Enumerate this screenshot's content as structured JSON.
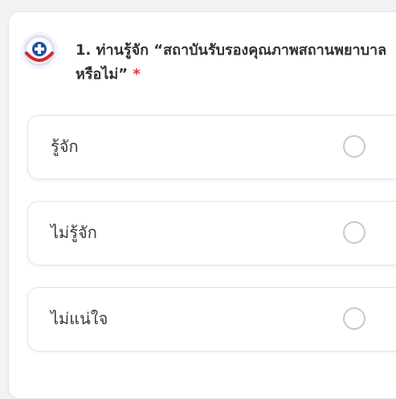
{
  "question": {
    "text": "1. ท่านรู้จัก “สถาบันรับรองคุณภาพสถานพยาบาลหรือไม่”",
    "required_marker": "*",
    "logo_icon": "hospital-accreditation-logo-icon"
  },
  "options": [
    {
      "label": "รู้จัก",
      "selected": false
    },
    {
      "label": "ไม่รู้จัก",
      "selected": false
    },
    {
      "label": "ไม่แน่ใจ",
      "selected": false
    }
  ],
  "colors": {
    "required": "#e53935",
    "text": "#333333",
    "radio_border": "#c9c9cc"
  }
}
